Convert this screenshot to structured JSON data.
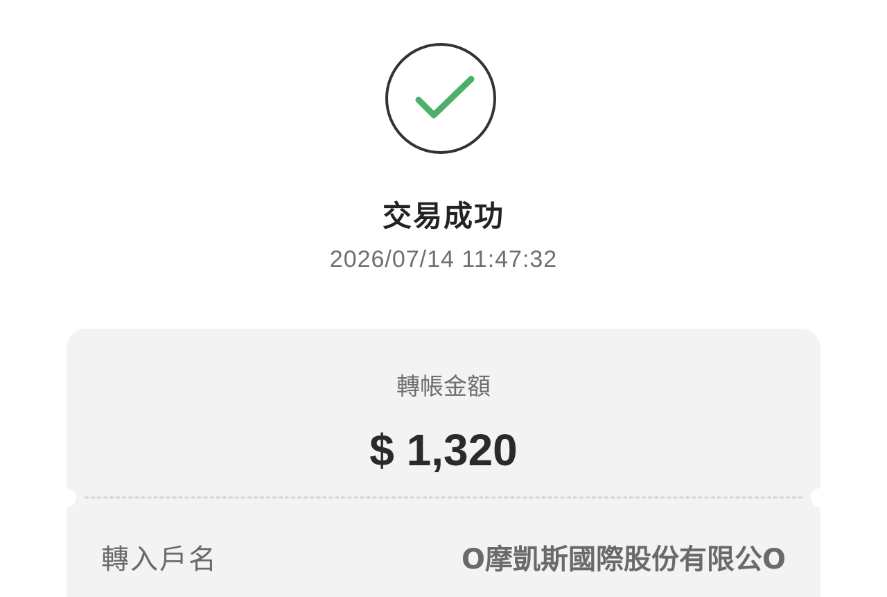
{
  "status": {
    "icon": "check-icon",
    "icon_color": "#4caf6a",
    "title": "交易成功",
    "datetime": "2026/07/14 11:47:32"
  },
  "transfer": {
    "amount_label": "轉帳金額",
    "amount_value": "$ 1,320",
    "payee_label": "轉入戶名",
    "payee_value": "O摩凱斯國際股份有限公O"
  },
  "colors": {
    "card_background": "#f3f3f3",
    "text_primary": "#222222",
    "text_secondary": "#6f6f6f"
  }
}
